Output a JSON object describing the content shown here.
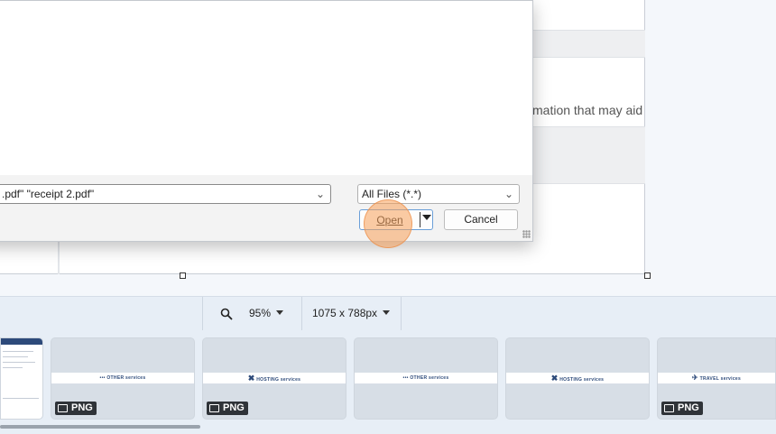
{
  "document": {
    "snippet": "mation that may aid i"
  },
  "dialog": {
    "filename_value": ".pdf\" \"receipt 2.pdf\"",
    "filetype_value": "All Files (*.*)",
    "open_label": "Open",
    "cancel_label": "Cancel"
  },
  "toolbar": {
    "zoom_icon": "magnifier-icon",
    "zoom_value": "95%",
    "size_value": "1075 x 788px"
  },
  "thumbnails": {
    "items": [
      {
        "logo": "OTHER services",
        "format": "PNG"
      },
      {
        "logo": "HOSTING services",
        "format": "PNG"
      },
      {
        "logo": "OTHER services",
        "format": ""
      },
      {
        "logo": "HOSTING services",
        "format": ""
      },
      {
        "logo": "TRAVEL services",
        "format": "PNG"
      }
    ]
  },
  "colors": {
    "accent": "#6a9fd8",
    "click_indicator": "#f7a05a",
    "toolbar_bg": "#e7eef6",
    "badge_bg": "#2f3338"
  }
}
